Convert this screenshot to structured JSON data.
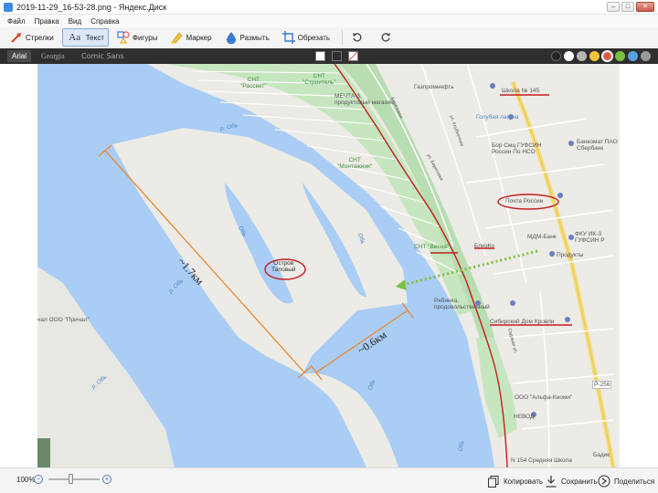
{
  "window": {
    "title": "2019-11-29_16-53-28.png - Яндекс.Диск",
    "controls": [
      "minimize",
      "maximize",
      "close"
    ]
  },
  "menu": [
    "Файл",
    "Правка",
    "Вид",
    "Справка"
  ],
  "toolbar": {
    "tools": [
      {
        "label": "Стрелки",
        "icon": "arrow-icon"
      },
      {
        "label": "Текст",
        "icon": "text-icon",
        "active": true
      },
      {
        "label": "Фигуры",
        "icon": "shapes-icon"
      },
      {
        "label": "Маркер",
        "icon": "marker-icon"
      },
      {
        "label": "Размыть",
        "icon": "blur-icon"
      },
      {
        "label": "Обрезать",
        "icon": "crop-icon"
      }
    ],
    "undo_icon": "undo-icon",
    "redo_icon": "redo-icon"
  },
  "subbar": {
    "fonts": [
      "Arial",
      "Georgia",
      "Comic Sans"
    ],
    "selected_font": "Arial",
    "text_backgrounds": [
      "#ffffff",
      "#2f2f2f",
      "none"
    ],
    "colors": [
      "#222222",
      "#ffffff",
      "#b6b6b6",
      "#f3c53a",
      "#5aa0e0",
      "#e05a4a",
      "#7cc043",
      "#9a9a9a"
    ],
    "selected_color": "#e05a4a"
  },
  "map": {
    "labels": {
      "snt_rassvet": "СНТ\n\"Рассвет\"",
      "snt_stroitel": "СНТ\n\"Строитель\"",
      "mechta": "МЕЧТА-3,\nпродуктовый магазин",
      "gazprom": "Газпромнефть",
      "school145": "Школа № 145",
      "golubaya": "Голубая лагуна",
      "boy": "Бор Смц ГУФСИН\nРоссии По НСО",
      "sberbank": "Банкомат ПАО\nСбербанк",
      "snt_montazhnik": "СНТ\n\"Монтажник\"",
      "pochta": "Почта России",
      "fku": "ФКУ ИК-3\nГУФСИН Р",
      "mdm": "МДМ-Банк",
      "snt_vesna": "СНТ \"Весна\"",
      "blizko": "БлизКо",
      "produkty": "Продукты",
      "ostrov": "Остров\nТаловый",
      "ryabinka": "Рябинка,\nпродовольственный",
      "sib_krovli": "Сибирский Дом Кровли",
      "prichal": "чал ООО \"Причал\"",
      "alfa": "ООО \"Альфа-Киоми\"",
      "nevod": "НЕВОД",
      "school154": "N 154 Средняя Школа",
      "badik": "Бадик",
      "r_ob_1": "р. Обь",
      "r_ob_2": "р. Обь",
      "r_ob_3": "р. Обь",
      "ob_small_1": "Обь",
      "ob_small_2": "Обь",
      "ob_small_3": "Обь",
      "ob_small_4": "Обь",
      "p256": "Р-256",
      "street_1": "Берёзовая",
      "street_2": "ул. Береговая",
      "street_3": "ул. Клубничная",
      "street_4": "Садовая ул."
    },
    "annotations": {
      "length": "~1.7км",
      "width": "~0.6км"
    }
  },
  "statusbar": {
    "zoom": "100%",
    "zoom_level": 0.45,
    "copy": "Копировать",
    "save": "Сохранить",
    "share": "Поделиться"
  }
}
